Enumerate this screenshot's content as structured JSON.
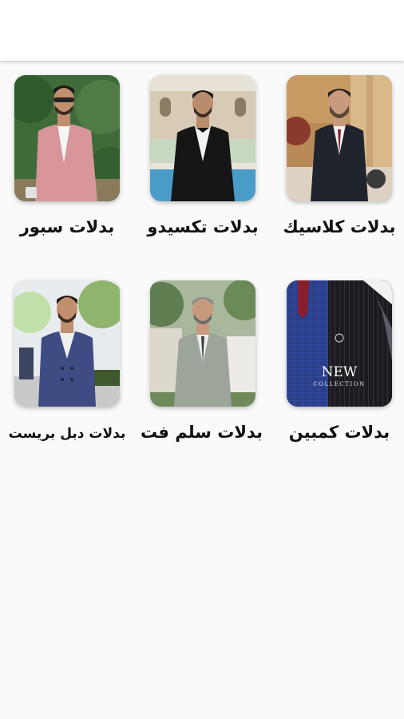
{
  "categories": [
    {
      "label": "بدلات كلاسيك",
      "image": "man-in-dark-classic-suit"
    },
    {
      "label": "بدلات تكسيدو",
      "image": "man-in-black-tuxedo"
    },
    {
      "label": "بدلات سبور",
      "image": "man-in-pink-casual-suit"
    },
    {
      "label": "بدلات كمبين",
      "image": "suit-fabric-collection-banner",
      "banner_title": "NEW",
      "banner_subtitle": "COLLECTION"
    },
    {
      "label": "بدلات سلم فت",
      "image": "man-in-grey-slim-fit-suit"
    },
    {
      "label": "بدلات دبل بريست",
      "image": "man-in-blue-double-breasted-suit"
    }
  ],
  "colors": {
    "app_bar": "#ffffff",
    "background": "#fafafa",
    "label_text": "#111111"
  }
}
